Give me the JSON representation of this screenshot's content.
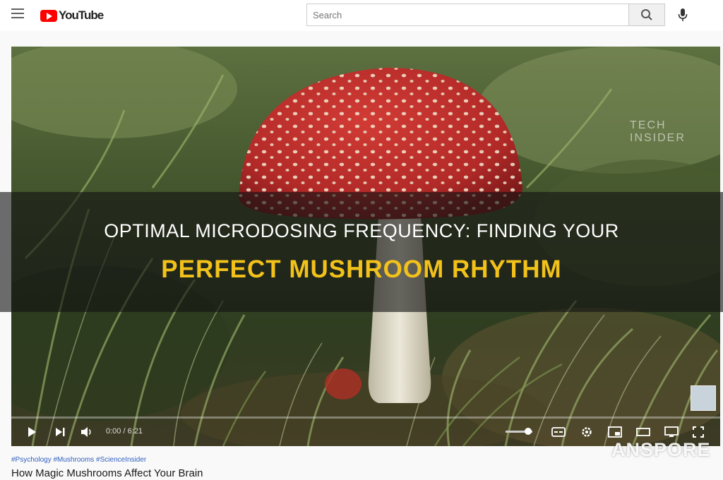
{
  "header": {
    "logo_text": "YouTube",
    "search_placeholder": "Search"
  },
  "video": {
    "watermark_line1": "TECH",
    "watermark_line2": "INSIDER",
    "time": "0:00 / 6:21",
    "progress": 0.0,
    "volume": 0.85
  },
  "overlay": {
    "line1": "OPTIMAL MICRODOSING FREQUENCY: FINDING YOUR",
    "line2": "PERFECT MUSHROOM RHYTHM"
  },
  "below": {
    "tags": "#Psychology #Mushrooms #ScienceInsider",
    "title": "How Magic Mushrooms Affect Your Brain"
  },
  "site_mark": "ANSPORE",
  "colors": {
    "brand_red": "#ff0000",
    "banner_yellow": "#f2c21a",
    "cap_red": "#c4302f"
  }
}
